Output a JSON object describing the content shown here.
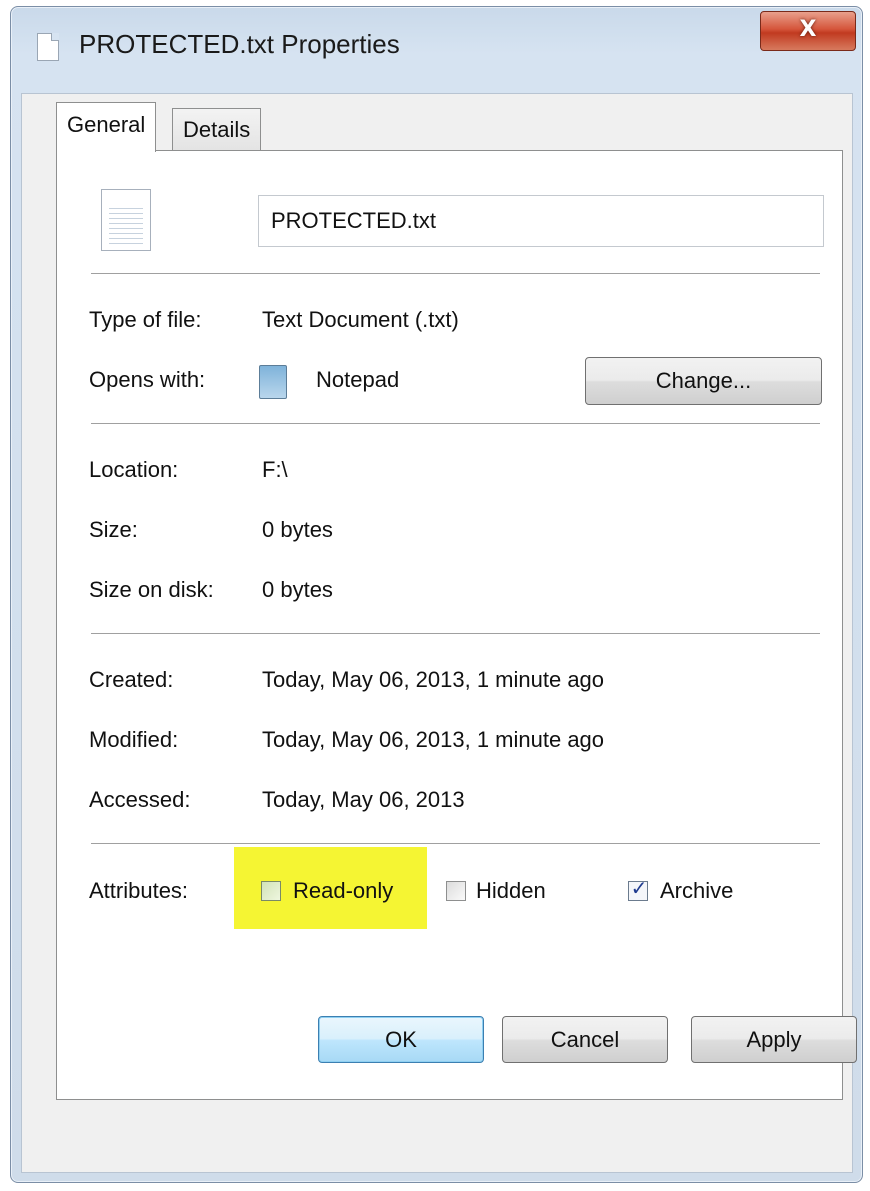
{
  "window": {
    "title": "PROTECTED.txt Properties",
    "close_label": "X"
  },
  "tabs": [
    {
      "label": "General",
      "active": true
    },
    {
      "label": "Details",
      "active": false
    }
  ],
  "general": {
    "file_name": "PROTECTED.txt",
    "type_label": "Type of file:",
    "type_value": "Text Document (.txt)",
    "opens_label": "Opens with:",
    "opens_value": "Notepad",
    "change_button": "Change...",
    "location_label": "Location:",
    "location_value": "F:\\",
    "size_label": "Size:",
    "size_value": "0 bytes",
    "size_disk_label": "Size on disk:",
    "size_disk_value": "0 bytes",
    "created_label": "Created:",
    "created_value": "Today, May 06, 2013, 1 minute ago",
    "modified_label": "Modified:",
    "modified_value": "Today, May 06, 2013, 1 minute ago",
    "accessed_label": "Accessed:",
    "accessed_value": "Today, May 06, 2013",
    "attributes_label": "Attributes:",
    "attributes": [
      {
        "label": "Read-only",
        "checked": false,
        "highlighted": true
      },
      {
        "label": "Hidden",
        "checked": false
      },
      {
        "label": "Archive",
        "checked": true
      }
    ]
  },
  "footer": {
    "ok": "OK",
    "cancel": "Cancel",
    "apply": "Apply"
  },
  "colors": {
    "highlight": "#f5f533",
    "checkmark": "#1f3b8f"
  }
}
